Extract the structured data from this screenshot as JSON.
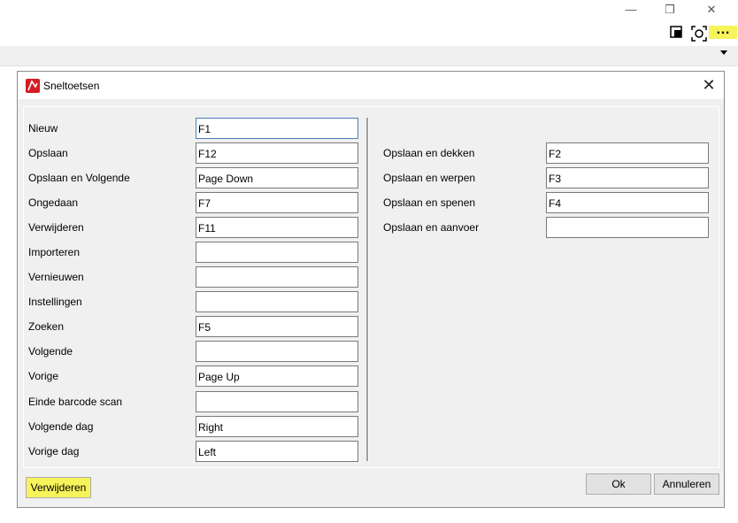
{
  "dialog": {
    "title": "Sneltoetsen"
  },
  "shortcuts_left": [
    {
      "label": "Nieuw",
      "value": "F1"
    },
    {
      "label": "Opslaan",
      "value": "F12"
    },
    {
      "label": "Opslaan en Volgende",
      "value": "Page Down"
    },
    {
      "label": "Ongedaan",
      "value": "F7"
    },
    {
      "label": "Verwijderen",
      "value": "F11"
    },
    {
      "label": "Importeren",
      "value": ""
    },
    {
      "label": "Vernieuwen",
      "value": ""
    },
    {
      "label": "Instellingen",
      "value": ""
    },
    {
      "label": "Zoeken",
      "value": "F5"
    },
    {
      "label": "Volgende",
      "value": ""
    },
    {
      "label": "Vorige",
      "value": "Page Up"
    },
    {
      "label": "Einde barcode scan",
      "value": ""
    },
    {
      "label": "Volgende dag",
      "value": "Right"
    },
    {
      "label": "Vorige dag",
      "value": "Left"
    }
  ],
  "shortcuts_right": [
    {
      "label": "Opslaan en dekken",
      "value": "F2"
    },
    {
      "label": "Opslaan en werpen",
      "value": "F3"
    },
    {
      "label": "Opslaan en spenen",
      "value": "F4"
    },
    {
      "label": "Opslaan en aanvoer",
      "value": ""
    }
  ],
  "buttons": {
    "delete": "Verwijderen",
    "ok": "Ok",
    "cancel": "Annuleren"
  },
  "colors": {
    "highlight": "#f7f35a",
    "app_icon": "#d31c24"
  }
}
